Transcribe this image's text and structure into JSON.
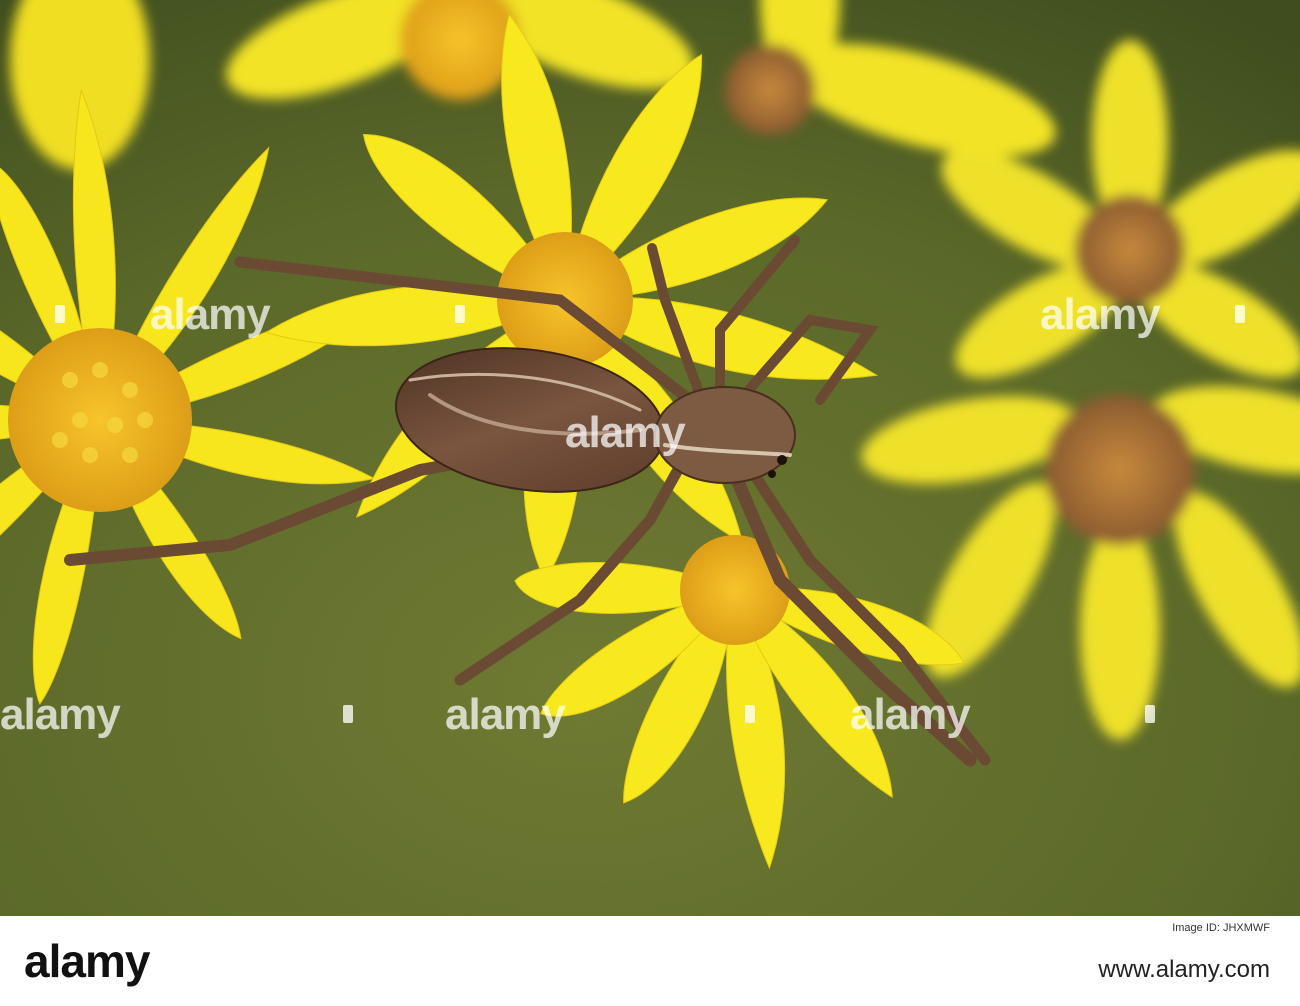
{
  "photo": {
    "subject": "spider-on-yellow-flowers",
    "colors": {
      "background_green": "#5d6a2a",
      "petal_yellow": "#f6e51c",
      "flower_center": "#e9b322",
      "spider_brown": "#6b4a33"
    }
  },
  "watermark": {
    "text": "alamy",
    "marks": [
      "a",
      "a",
      "a",
      "a",
      "a",
      "a"
    ]
  },
  "footer": {
    "logo": "alamy",
    "image_id": "Image ID: JHXMWF",
    "url": "www.alamy.com"
  }
}
